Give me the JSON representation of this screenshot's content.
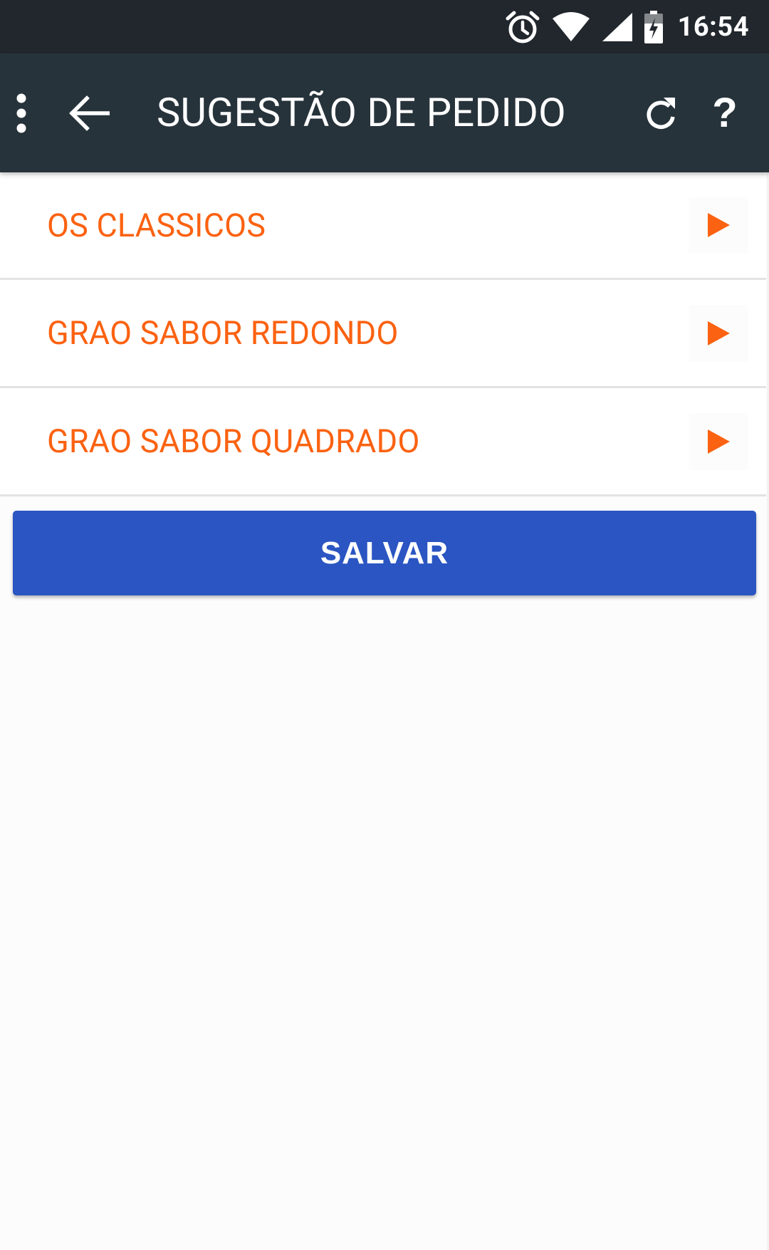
{
  "status_bar": {
    "time": "16:54",
    "icons": [
      "alarm-icon",
      "wifi-icon",
      "signal-icon",
      "battery-charging-icon"
    ]
  },
  "toolbar": {
    "title": "SUGESTÃO DE PEDIDO",
    "menu_icon": "more-vert-icon",
    "back_icon": "arrow-back-icon",
    "refresh_icon": "refresh-icon",
    "help_icon": "help-icon",
    "help_glyph": "?"
  },
  "categories": [
    {
      "label": "OS CLASSICOS",
      "icon": "play-arrow-icon"
    },
    {
      "label": "GRAO SABOR REDONDO",
      "icon": "play-arrow-icon"
    },
    {
      "label": "GRAO SABOR QUADRADO",
      "icon": "play-arrow-icon"
    }
  ],
  "actions": {
    "save_label": "SALVAR"
  },
  "colors": {
    "status_bar": "#21272d",
    "toolbar": "#27333b",
    "accent_orange": "#fb6211",
    "button_blue": "#2a55c2",
    "background": "#fcfcfc"
  }
}
